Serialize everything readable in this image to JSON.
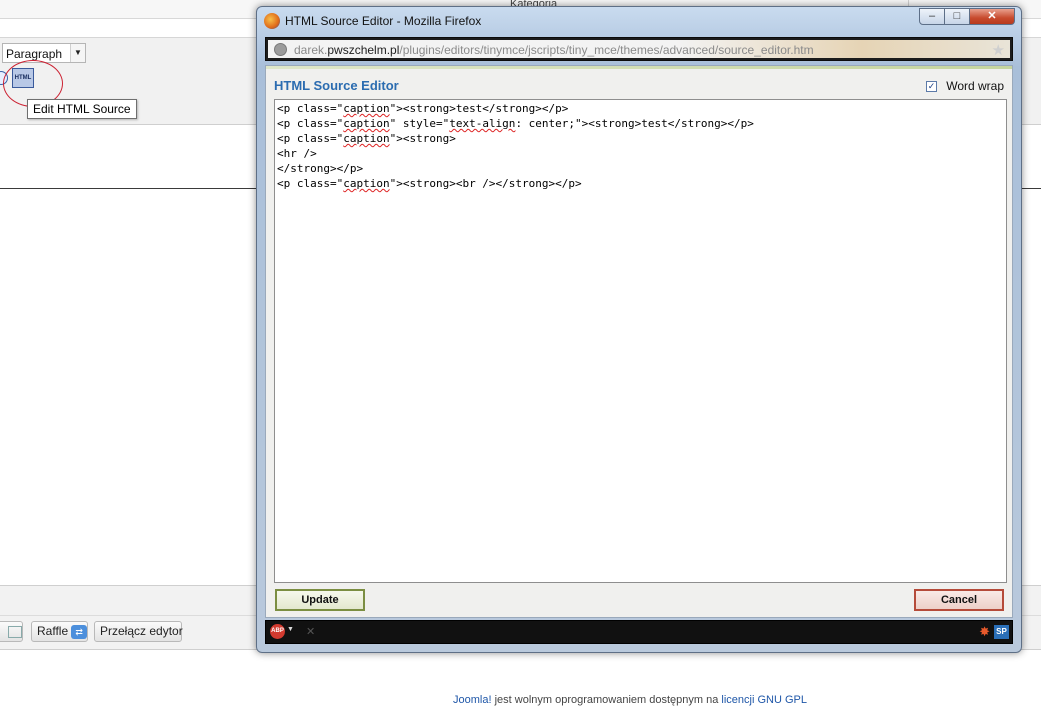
{
  "background": {
    "top_fragment": "Kategoria",
    "format_select": {
      "value": "Paragraph"
    },
    "html_button": {
      "icon_text": "HTML"
    },
    "tooltip": "Edit HTML Source",
    "bottom_buttons": {
      "raffle": "Raffle",
      "toggle_editor": "Przełącz edytor"
    },
    "footer": {
      "brand": "Joomla!",
      "text": " jest wolnym oprogramowaniem dostępnym na ",
      "license": "licencji GNU GPL"
    }
  },
  "window": {
    "title": "HTML Source Editor - Mozilla Firefox",
    "controls": {
      "minimize": "–",
      "maximize": "□",
      "close": "✕"
    },
    "url": {
      "prefix": "darek.",
      "domain": "pwszchelm.pl",
      "path": "/plugins/editors/tinymce/jscripts/tiny_mce/themes/advanced/source_editor.htm"
    }
  },
  "dialog": {
    "title": "HTML Source Editor",
    "word_wrap": {
      "label": "Word wrap",
      "checked": true,
      "check_glyph": "✓"
    },
    "source_lines": [
      "<p class=\"caption\"><strong>test</strong></p>",
      "<p class=\"caption\" style=\"text-align: center;\"><strong>test</strong></p>",
      "<p class=\"caption\"><strong>",
      "<hr />",
      "</strong></p>",
      "<p class=\"caption\"><strong><br /></strong></p>"
    ],
    "update_label": "Update",
    "cancel_label": "Cancel"
  },
  "statusbar": {
    "abp": "ABP",
    "close_glyph": "✕",
    "sp": "SP"
  },
  "colors": {
    "dialog_title": "#2b6cb0",
    "update_border": "#7b8e42",
    "cancel_border": "#b54b3a",
    "link": "#1f57a8"
  }
}
